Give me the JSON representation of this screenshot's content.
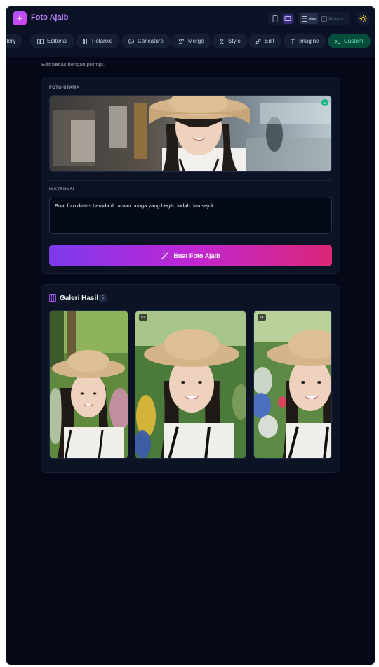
{
  "header": {
    "app_title": "Foto Ajaib",
    "layout_options": [
      "Atas",
      "Samping"
    ],
    "active_layout": "Atas"
  },
  "tabs": [
    {
      "label": "Gallery",
      "icon": "gallery-icon"
    },
    {
      "label": "Editorial",
      "icon": "book-icon"
    },
    {
      "label": "Polaroid",
      "icon": "film-icon"
    },
    {
      "label": "Caricature",
      "icon": "smile-icon"
    },
    {
      "label": "Merge",
      "icon": "users-icon"
    },
    {
      "label": "Style",
      "icon": "user-icon"
    },
    {
      "label": "Edit",
      "icon": "pencil-icon"
    },
    {
      "label": "Imagine",
      "icon": "type-icon"
    },
    {
      "label": "Custom",
      "icon": "terminal-icon",
      "active": true
    }
  ],
  "subtitle": "Edit bebas dengan prompt.",
  "editor": {
    "main_photo_label": "FOTO UTAMA",
    "instruction_label": "INSTRUKSI",
    "instruction_value": "Buat foto diatas berada di taman bunga yang begitu indah dan sejuk",
    "generate_button": "Buat Foto Ajaib"
  },
  "gallery": {
    "title": "Galeri Hasil",
    "count": "5",
    "items": [
      {
        "badge": ""
      },
      {
        "badge": "#3"
      },
      {
        "badge": "#4"
      }
    ]
  },
  "colors": {
    "accent": "#a855f7",
    "active_tab_bg": "#064e3b",
    "active_tab_text": "#6ee7b7",
    "button_gradient": [
      "#7c3aed",
      "#c026d3",
      "#db2777"
    ]
  }
}
